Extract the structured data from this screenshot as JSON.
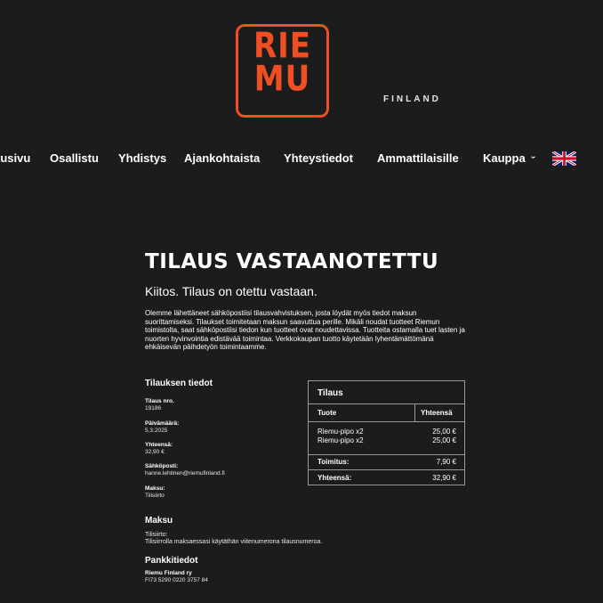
{
  "brand": {
    "logo_line1": "RIE",
    "logo_line2": "MU",
    "logo_sub": "FINLAND"
  },
  "nav": {
    "items": [
      "tusivu",
      "Osallistu",
      "Yhdistys",
      "Ajankohtaista",
      "Yhteystiedot",
      "Ammattilaisille",
      "Kauppa"
    ],
    "kauppa_chevron": "›"
  },
  "order_received": {
    "title": "TILAUS VASTAANOTETTU",
    "lead": "Kiitos. Tilaus on otettu vastaan.",
    "paragraph": "Olemme lähettäneet sähköpostiisi tilausvahvistuksen, josta löydät myös tiedot maksun suorittamiseksi. Tilaukset toimitetaan maksun saavuttua perille. Mikäli noudat tuotteet Riemun toimistolta, saat sähköpostiisi tiedon kun tuotteet ovat noudettavissa. Tuotteita ostamalla tuet lasten ja nuorten hyvinvointia edistävää toimintaa. Verkkokaupan tuotto käytetään lyhentämättömänä ehkäisevän päihdetyön toimintaamme."
  },
  "details": {
    "heading": "Tilauksen tiedot",
    "fields": [
      {
        "label": "Tilaus nro.",
        "value": "19186"
      },
      {
        "label": "Päivämäärä:",
        "value": "5.3.2025"
      },
      {
        "label": "Yhteensä:",
        "value": "32,90 €"
      },
      {
        "label": "Sähköposti:",
        "value": "hanne.lehtinen@riemufinland.fi"
      },
      {
        "label": "Maksu:",
        "value": "Tilisiirto"
      }
    ]
  },
  "order_table": {
    "heading": "Tilaus",
    "col_product": "Tuote",
    "col_total": "Yhteensä",
    "items": [
      {
        "name": "Riemu-pipo x2",
        "price": "25,00 €"
      },
      {
        "name": "Riemu-pipo x2",
        "price": "25,00 €"
      }
    ],
    "shipping_label": "Toimitus:",
    "shipping_value": "7,90 €",
    "total_label": "Yhteensä:",
    "total_value": "32,90 €"
  },
  "payment": {
    "heading": "Maksu",
    "line1": "Tilisiirto:",
    "line2": "Tilisiirrolla maksaessasi käytäthän viitenumerona tilausnumeroa."
  },
  "bank": {
    "heading": "Pankkitiedot",
    "name": "Riemu Finland ry",
    "iban": "FI73 5290 0220 3757 84"
  },
  "colors": {
    "accent": "#f04e23",
    "background": "#1c1c1c",
    "text": "#ffffff",
    "border": "#9a9a9a"
  }
}
